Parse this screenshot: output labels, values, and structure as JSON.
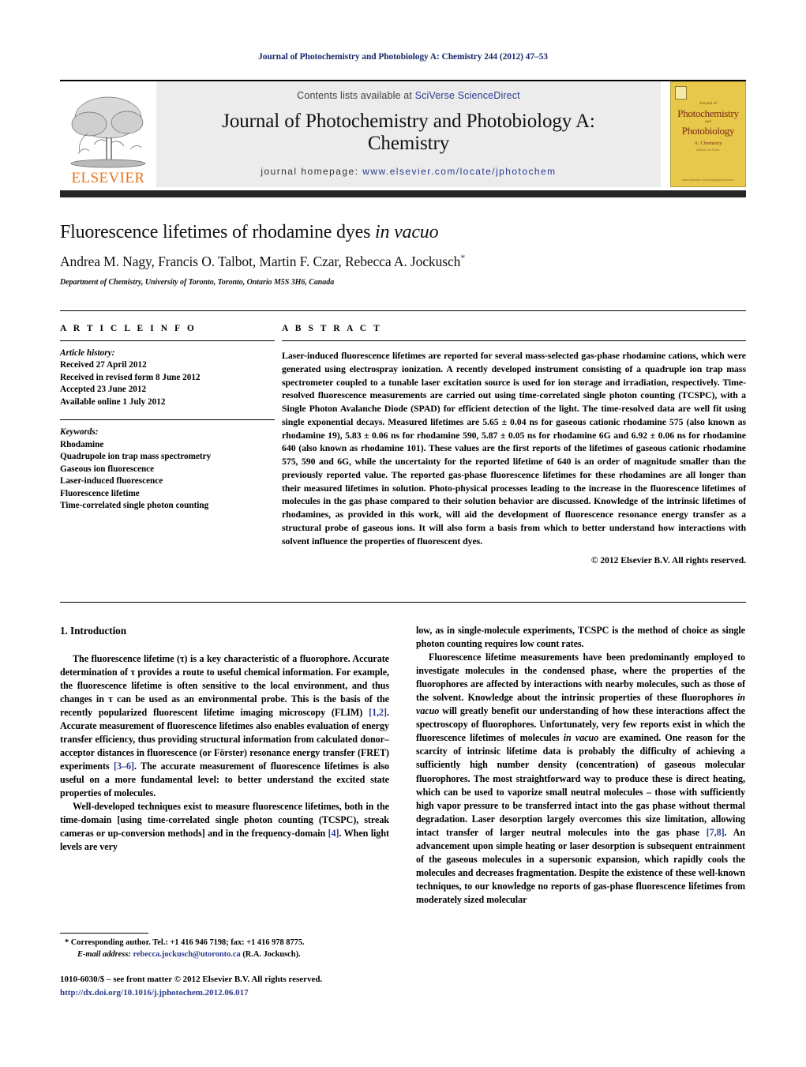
{
  "running_head": "Journal of Photochemistry and Photobiology A: Chemistry 244 (2012) 47–53",
  "masthead": {
    "contents_prefix": "Contents lists available at ",
    "sciencedirect_link": "SciVerse ScienceDirect",
    "journal_title_line1": "Journal of Photochemistry and Photobiology A:",
    "journal_title_line2": "Chemistry",
    "homepage_label": "journal homepage: ",
    "homepage_url": "www.elsevier.com/locate/jphotochem",
    "elsevier_wordmark": "ELSEVIER",
    "cover": {
      "kicker": "Journal of",
      "title1": "Photochemistry",
      "and": "and",
      "title2": "Photobiology",
      "sub": "A: Chemistry",
      "sub2": "Editors-in-Chief",
      "foot": "www.elsevier.com/locate/jphotochem"
    }
  },
  "article": {
    "title_main": "Fluorescence lifetimes of rhodamine dyes ",
    "title_italic": "in vacuo",
    "authors": "Andrea M. Nagy, Francis O. Talbot, Martin F. Czar, Rebecca A. Jockusch",
    "corresponding_marker": "*",
    "affiliation": "Department of Chemistry, University of Toronto, Toronto, Ontario M5S 3H6, Canada"
  },
  "article_info": {
    "heading": "A R T I C L E    I N F O",
    "history_label": "Article history:",
    "history": [
      "Received 27 April 2012",
      "Received in revised form 8 June 2012",
      "Accepted 23 June 2012",
      "Available online 1 July 2012"
    ],
    "keywords_label": "Keywords:",
    "keywords": [
      "Rhodamine",
      "Quadrupole ion trap mass spectrometry",
      "Gaseous ion fluorescence",
      "Laser-induced fluorescence",
      "Fluorescence lifetime",
      "Time-correlated single photon counting"
    ]
  },
  "abstract": {
    "heading": "A B S T R A C T",
    "text": "Laser-induced fluorescence lifetimes are reported for several mass-selected gas-phase rhodamine cations, which were generated using electrospray ionization. A recently developed instrument consisting of a quadruple ion trap mass spectrometer coupled to a tunable laser excitation source is used for ion storage and irradiation, respectively. Time-resolved fluorescence measurements are carried out using time-correlated single photon counting (TCSPC), with a Single Photon Avalanche Diode (SPAD) for efficient detection of the light. The time-resolved data are well fit using single exponential decays. Measured lifetimes are 5.65 ± 0.04 ns for gaseous cationic rhodamine 575 (also known as rhodamine 19), 5.83 ± 0.06 ns for rhodamine 590, 5.87 ± 0.05 ns for rhodamine 6G and 6.92 ± 0.06 ns for rhodamine 640 (also known as rhodamine 101). These values are the first reports of the lifetimes of gaseous cationic rhodamine 575, 590 and 6G, while the uncertainty for the reported lifetime of 640 is an order of magnitude smaller than the previously reported value. The reported gas-phase fluorescence lifetimes for these rhodamines are all longer than their measured lifetimes in solution. Photo-physical processes leading to the increase in the fluorescence lifetimes of molecules in the gas phase compared to their solution behavior are discussed. Knowledge of the intrinsic lifetimes of rhodamines, as provided in this work, will aid the development of fluorescence resonance energy transfer as a structural probe of gaseous ions. It will also form a basis from which to better understand how interactions with solvent influence the properties of fluorescent dyes.",
    "copyright": "© 2012 Elsevier B.V. All rights reserved."
  },
  "body": {
    "section_number_title": "1. Introduction",
    "left_p1_a": "The fluorescence lifetime (τ) is a key characteristic of a fluorophore. Accurate determination of τ provides a route to useful chemical information. For example, the fluorescence lifetime is often sensitive to the local environment, and thus changes in τ can be used as an environmental probe. This is the basis of the recently popularized fluorescent lifetime imaging microscopy (FLIM) ",
    "left_p1_ref1": "[1,2]",
    "left_p1_b": ". Accurate measurement of fluorescence lifetimes also enables evaluation of energy transfer efficiency, thus providing structural information from calculated donor–acceptor distances in fluorescence (or Förster) resonance energy transfer (FRET) experiments ",
    "left_p1_ref2": "[3–6]",
    "left_p1_c": ". The accurate measurement of fluorescence lifetimes is also useful on a more fundamental level: to better understand the excited state properties of molecules.",
    "left_p2_a": "Well-developed techniques exist to measure fluorescence lifetimes, both in the time-domain [using time-correlated single photon counting (TCSPC), streak cameras or up-conversion methods] and in the frequency-domain ",
    "left_p2_ref": "[4]",
    "left_p2_b": ". When light levels are very",
    "right_p1": "low, as in single-molecule experiments, TCSPC is the method of choice as single photon counting requires low count rates.",
    "right_p2_a": "Fluorescence lifetime measurements have been predominantly employed to investigate molecules in the condensed phase, where the properties of the fluorophores are affected by interactions with nearby molecules, such as those of the solvent. Knowledge about the intrinsic properties of these fluorophores ",
    "right_p2_ital1": "in vacuo",
    "right_p2_b": " will greatly benefit our understanding of how these interactions affect the spectroscopy of fluorophores. Unfortunately, very few reports exist in which the fluorescence lifetimes of molecules ",
    "right_p2_ital2": "in vacuo",
    "right_p2_c": " are examined. One reason for the scarcity of intrinsic lifetime data is probably the difficulty of achieving a sufficiently high number density (concentration) of gaseous molecular fluorophores. The most straightforward way to produce these is direct heating, which can be used to vaporize small neutral molecules – those with sufficiently high vapor pressure to be transferred intact into the gas phase without thermal degradation. Laser desorption largely overcomes this size limitation, allowing intact transfer of larger neutral molecules into the gas phase ",
    "right_p2_ref": "[7,8]",
    "right_p2_d": ". An advancement upon simple heating or laser desorption is subsequent entrainment of the gaseous molecules in a supersonic expansion, which rapidly cools the molecules and decreases fragmentation. Despite the existence of these well-known techniques, to our knowledge no reports of gas-phase fluorescence lifetimes from moderately sized molecular"
  },
  "footnote": {
    "marker": "*",
    "corresponding": " Corresponding author. Tel.: +1 416 946 7198; fax: +1 416 978 8775.",
    "email_label": "E-mail address:",
    "email": "rebecca.jockusch@utoronto.ca",
    "email_suffix": " (R.A. Jockusch)."
  },
  "footer": {
    "issn_line": "1010-6030/$ – see front matter © 2012 Elsevier B.V. All rights reserved.",
    "doi": "http://dx.doi.org/10.1016/j.jphotochem.2012.06.017"
  },
  "colors": {
    "link": "#2b3c8f",
    "elsevier_orange": "#e87722",
    "masthead_bg": "#ececec",
    "bar_dark": "#262626",
    "cover_yellow": "#e8c84a"
  }
}
